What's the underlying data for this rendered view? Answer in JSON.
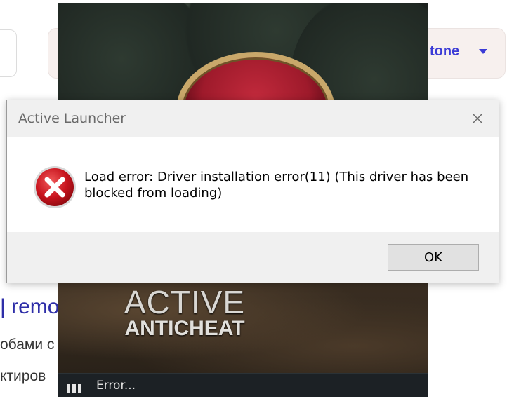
{
  "background_page": {
    "pill_text": "tone",
    "link_text": "| remo",
    "line1": "обами с",
    "line2": "ктиров"
  },
  "splash": {
    "brand_line1": "ACTIVE",
    "brand_line2": "ANTICHEAT",
    "status_text": "Error...",
    "status_icon": "loading-bars-icon"
  },
  "dialog": {
    "title": "Active Launcher",
    "close_icon": "close-icon",
    "error_icon": "error-icon",
    "message": "Load error: Driver installation error(11) (This driver has been blocked from loading)",
    "ok_label": "OK"
  }
}
